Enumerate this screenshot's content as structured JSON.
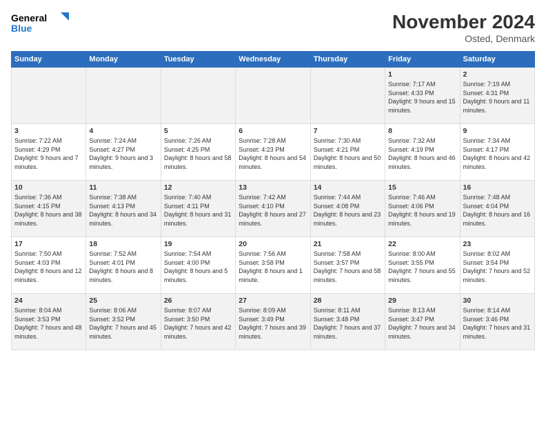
{
  "logo": {
    "line1": "General",
    "line2": "Blue"
  },
  "title": "November 2024",
  "subtitle": "Osted, Denmark",
  "days_header": [
    "Sunday",
    "Monday",
    "Tuesday",
    "Wednesday",
    "Thursday",
    "Friday",
    "Saturday"
  ],
  "weeks": [
    [
      {
        "num": "",
        "info": ""
      },
      {
        "num": "",
        "info": ""
      },
      {
        "num": "",
        "info": ""
      },
      {
        "num": "",
        "info": ""
      },
      {
        "num": "",
        "info": ""
      },
      {
        "num": "1",
        "info": "Sunrise: 7:17 AM\nSunset: 4:33 PM\nDaylight: 9 hours and 15 minutes."
      },
      {
        "num": "2",
        "info": "Sunrise: 7:19 AM\nSunset: 4:31 PM\nDaylight: 9 hours and 11 minutes."
      }
    ],
    [
      {
        "num": "3",
        "info": "Sunrise: 7:22 AM\nSunset: 4:29 PM\nDaylight: 9 hours and 7 minutes."
      },
      {
        "num": "4",
        "info": "Sunrise: 7:24 AM\nSunset: 4:27 PM\nDaylight: 9 hours and 3 minutes."
      },
      {
        "num": "5",
        "info": "Sunrise: 7:26 AM\nSunset: 4:25 PM\nDaylight: 8 hours and 58 minutes."
      },
      {
        "num": "6",
        "info": "Sunrise: 7:28 AM\nSunset: 4:23 PM\nDaylight: 8 hours and 54 minutes."
      },
      {
        "num": "7",
        "info": "Sunrise: 7:30 AM\nSunset: 4:21 PM\nDaylight: 8 hours and 50 minutes."
      },
      {
        "num": "8",
        "info": "Sunrise: 7:32 AM\nSunset: 4:19 PM\nDaylight: 8 hours and 46 minutes."
      },
      {
        "num": "9",
        "info": "Sunrise: 7:34 AM\nSunset: 4:17 PM\nDaylight: 8 hours and 42 minutes."
      }
    ],
    [
      {
        "num": "10",
        "info": "Sunrise: 7:36 AM\nSunset: 4:15 PM\nDaylight: 8 hours and 38 minutes."
      },
      {
        "num": "11",
        "info": "Sunrise: 7:38 AM\nSunset: 4:13 PM\nDaylight: 8 hours and 34 minutes."
      },
      {
        "num": "12",
        "info": "Sunrise: 7:40 AM\nSunset: 4:11 PM\nDaylight: 8 hours and 31 minutes."
      },
      {
        "num": "13",
        "info": "Sunrise: 7:42 AM\nSunset: 4:10 PM\nDaylight: 8 hours and 27 minutes."
      },
      {
        "num": "14",
        "info": "Sunrise: 7:44 AM\nSunset: 4:08 PM\nDaylight: 8 hours and 23 minutes."
      },
      {
        "num": "15",
        "info": "Sunrise: 7:46 AM\nSunset: 4:06 PM\nDaylight: 8 hours and 19 minutes."
      },
      {
        "num": "16",
        "info": "Sunrise: 7:48 AM\nSunset: 4:04 PM\nDaylight: 8 hours and 16 minutes."
      }
    ],
    [
      {
        "num": "17",
        "info": "Sunrise: 7:50 AM\nSunset: 4:03 PM\nDaylight: 8 hours and 12 minutes."
      },
      {
        "num": "18",
        "info": "Sunrise: 7:52 AM\nSunset: 4:01 PM\nDaylight: 8 hours and 8 minutes."
      },
      {
        "num": "19",
        "info": "Sunrise: 7:54 AM\nSunset: 4:00 PM\nDaylight: 8 hours and 5 minutes."
      },
      {
        "num": "20",
        "info": "Sunrise: 7:56 AM\nSunset: 3:58 PM\nDaylight: 8 hours and 1 minute."
      },
      {
        "num": "21",
        "info": "Sunrise: 7:58 AM\nSunset: 3:57 PM\nDaylight: 7 hours and 58 minutes."
      },
      {
        "num": "22",
        "info": "Sunrise: 8:00 AM\nSunset: 3:55 PM\nDaylight: 7 hours and 55 minutes."
      },
      {
        "num": "23",
        "info": "Sunrise: 8:02 AM\nSunset: 3:54 PM\nDaylight: 7 hours and 52 minutes."
      }
    ],
    [
      {
        "num": "24",
        "info": "Sunrise: 8:04 AM\nSunset: 3:53 PM\nDaylight: 7 hours and 48 minutes."
      },
      {
        "num": "25",
        "info": "Sunrise: 8:06 AM\nSunset: 3:52 PM\nDaylight: 7 hours and 45 minutes."
      },
      {
        "num": "26",
        "info": "Sunrise: 8:07 AM\nSunset: 3:50 PM\nDaylight: 7 hours and 42 minutes."
      },
      {
        "num": "27",
        "info": "Sunrise: 8:09 AM\nSunset: 3:49 PM\nDaylight: 7 hours and 39 minutes."
      },
      {
        "num": "28",
        "info": "Sunrise: 8:11 AM\nSunset: 3:48 PM\nDaylight: 7 hours and 37 minutes."
      },
      {
        "num": "29",
        "info": "Sunrise: 8:13 AM\nSunset: 3:47 PM\nDaylight: 7 hours and 34 minutes."
      },
      {
        "num": "30",
        "info": "Sunrise: 8:14 AM\nSunset: 3:46 PM\nDaylight: 7 hours and 31 minutes."
      }
    ]
  ]
}
